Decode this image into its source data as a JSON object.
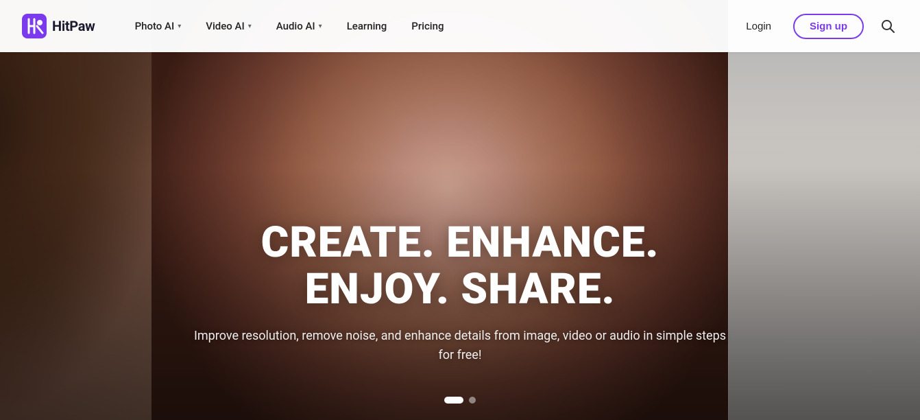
{
  "brand": {
    "name": "HitPaw"
  },
  "navbar": {
    "logo_text": "HitPaw",
    "nav_items": [
      {
        "label": "Photo AI",
        "has_dropdown": true
      },
      {
        "label": "Video AI",
        "has_dropdown": true
      },
      {
        "label": "Audio AI",
        "has_dropdown": true
      },
      {
        "label": "Learning",
        "has_dropdown": false
      },
      {
        "label": "Pricing",
        "has_dropdown": false
      }
    ],
    "login_label": "Login",
    "signup_label": "Sign up"
  },
  "hero": {
    "headline": "CREATE. ENHANCE. ENJOY. SHARE.",
    "subtext": "Improve resolution, remove noise, and enhance details from image, video\nor audio in simple steps for free!",
    "dots": [
      {
        "active": true
      },
      {
        "active": false
      }
    ]
  }
}
